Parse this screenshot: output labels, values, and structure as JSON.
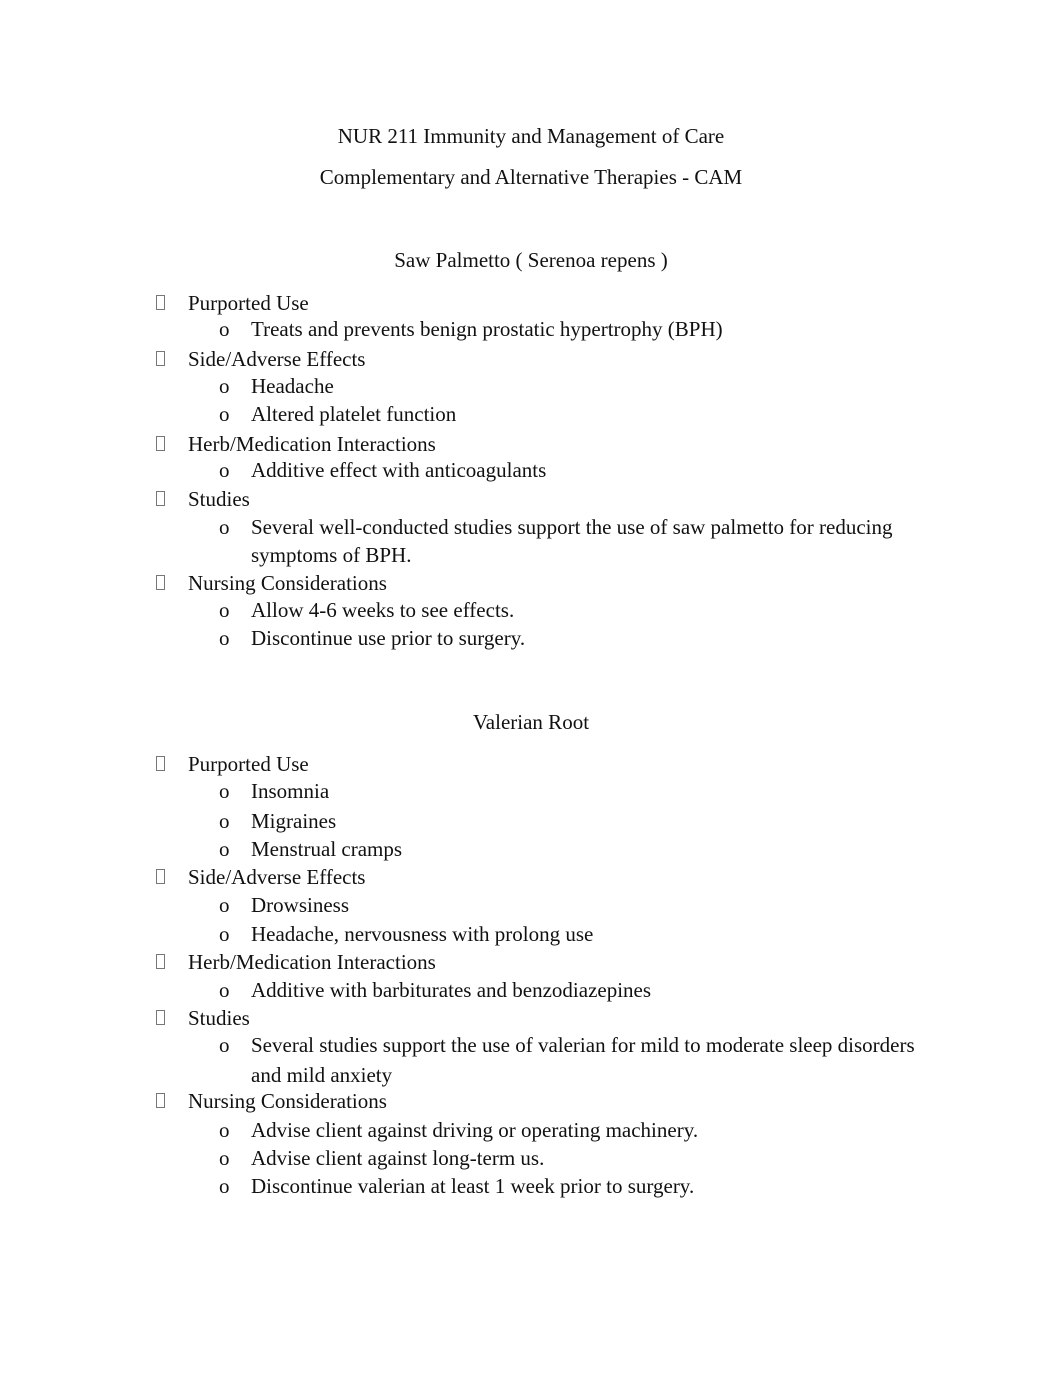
{
  "header": {
    "title": "NUR 211 Immunity and Management of Care",
    "subtitle": "Complementary and Alternative Therapies - CAM"
  },
  "bullet_glyphs": {
    "level1": "missing-glyph-box",
    "level2": "o"
  },
  "sections": [
    {
      "heading": "Saw Palmetto ( Serenoa repens )",
      "groups": [
        {
          "label": "Purported Use",
          "items": [
            "Treats and prevents benign prostatic hypertrophy (BPH)"
          ]
        },
        {
          "label": "Side/Adverse Effects",
          "items": [
            "Headache",
            "Altered platelet function"
          ]
        },
        {
          "label": "Herb/Medication Interactions",
          "items": [
            "Additive effect with anticoagulants"
          ]
        },
        {
          "label": "Studies",
          "items": [
            "Several well-conducted studies support the use of saw palmetto for reducing",
            "symptoms of BPH."
          ]
        },
        {
          "label": "Nursing Considerations",
          "items": [
            "Allow 4-6 weeks to see effects.",
            "Discontinue use prior to surgery."
          ]
        }
      ]
    },
    {
      "heading": "Valerian Root",
      "groups": [
        {
          "label": "Purported Use",
          "items": [
            "Insomnia",
            "Migraines",
            "Menstrual cramps"
          ]
        },
        {
          "label": "Side/Adverse Effects",
          "items": [
            "Drowsiness",
            "Headache, nervousness with prolong use"
          ]
        },
        {
          "label": "Herb/Medication Interactions",
          "items": [
            "Additive with barbiturates and benzodiazepines"
          ]
        },
        {
          "label": "Studies",
          "items": [
            "Several studies support the use of valerian for mild to moderate sleep disorders",
            "and mild anxiety"
          ]
        },
        {
          "label": "Nursing Considerations",
          "items": [
            "Advise client against driving or operating machinery.",
            "Advise client against long-term us.",
            "Discontinue valerian at least 1 week prior to surgery."
          ]
        }
      ]
    }
  ]
}
